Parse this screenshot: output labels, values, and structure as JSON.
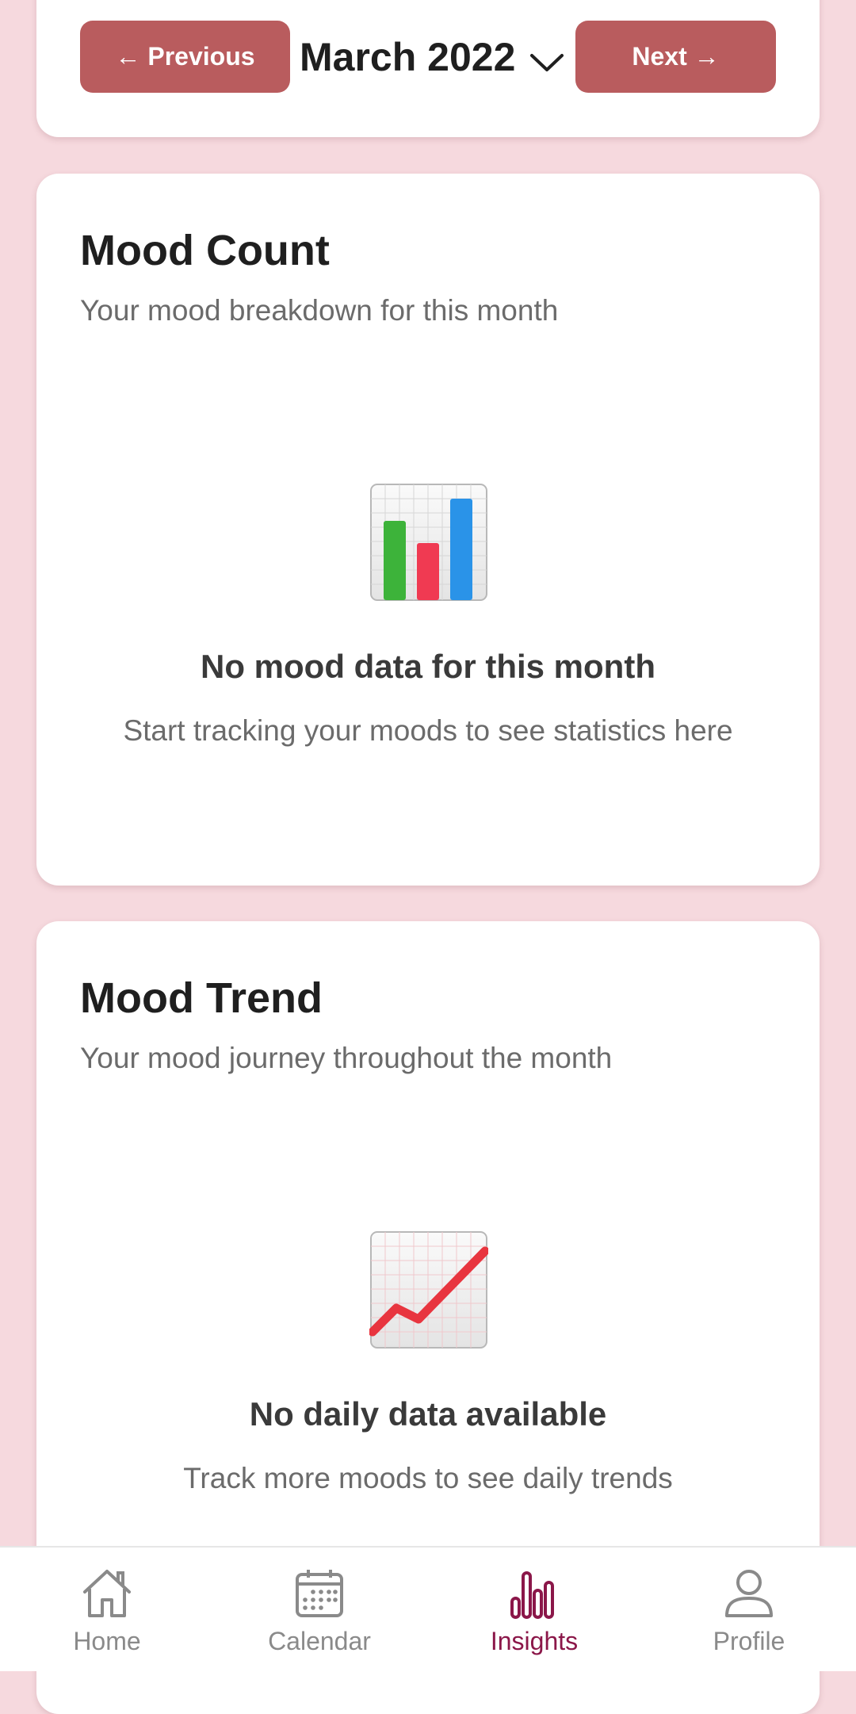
{
  "month_nav": {
    "prev_label": "← Previous",
    "month": "March 2022",
    "next_label": "Next →"
  },
  "mood_count": {
    "title": "Mood Count",
    "subtitle": "Your mood breakdown for this month",
    "empty_icon": "bar-chart-emoji",
    "empty_title": "No mood data for this month",
    "empty_subtitle": "Start tracking your moods to see statistics here"
  },
  "mood_trend": {
    "title": "Mood Trend",
    "subtitle": "Your mood journey throughout the month",
    "empty_icon": "chart-increasing-emoji",
    "empty_title": "No daily data available",
    "empty_subtitle": "Track more moods to see daily trends"
  },
  "tabbar": {
    "items": [
      {
        "label": "Home",
        "icon": "home-icon"
      },
      {
        "label": "Calendar",
        "icon": "calendar-icon"
      },
      {
        "label": "Insights",
        "icon": "insights-icon"
      },
      {
        "label": "Profile",
        "icon": "profile-icon"
      }
    ],
    "active": "Insights"
  },
  "colors": {
    "background": "#f6d9de",
    "button": "#b95c5e",
    "active_tab": "#8b1749"
  }
}
